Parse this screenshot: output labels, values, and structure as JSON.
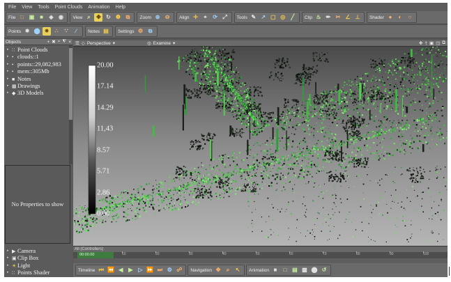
{
  "menu": [
    "File",
    "View",
    "Tools",
    "Point Clouds",
    "Animation",
    "Help"
  ],
  "toolbar1": [
    {
      "label": "File",
      "icons": [
        {
          "name": "new-icon",
          "glyph": "□"
        },
        {
          "name": "open-icon",
          "glyph": "▣"
        },
        {
          "name": "save-icon",
          "glyph": "■"
        },
        {
          "name": "import-icon",
          "glyph": "◈"
        },
        {
          "name": "export-icon",
          "glyph": "◉"
        }
      ]
    },
    {
      "label": "View",
      "icons": [
        {
          "name": "zoom-view-icon",
          "glyph": "⌕"
        },
        {
          "name": "pan-icon",
          "glyph": "✥",
          "active": true
        },
        {
          "name": "rotate-icon",
          "glyph": "↻"
        },
        {
          "name": "orbit-icon",
          "glyph": "❁"
        },
        {
          "name": "fit-icon",
          "glyph": "⧉"
        }
      ]
    },
    {
      "label": "Zoom",
      "icons": [
        {
          "name": "zoom-in-icon",
          "glyph": "⊕"
        },
        {
          "name": "zoom-out-icon",
          "glyph": "⊖"
        }
      ]
    },
    {
      "label": "Align",
      "icons": [
        {
          "name": "align-move-icon",
          "glyph": "✛"
        },
        {
          "name": "align-point-icon",
          "glyph": "⌖"
        },
        {
          "name": "align-rotate-icon",
          "glyph": "⟳"
        },
        {
          "name": "align-scale-icon",
          "glyph": "⤢"
        }
      ]
    },
    {
      "label": "Tools",
      "icons": [
        {
          "name": "pencil-icon",
          "glyph": "✎"
        },
        {
          "name": "measure-icon",
          "glyph": "↗"
        },
        {
          "name": "select-box-icon",
          "glyph": "▢"
        },
        {
          "name": "lasso-icon",
          "glyph": "◎"
        },
        {
          "name": "line-tool-icon",
          "glyph": "╱"
        }
      ]
    },
    {
      "label": "Clip",
      "icons": [
        {
          "name": "clip-fire-icon",
          "glyph": "♨"
        },
        {
          "name": "clip-pencil-icon",
          "glyph": "✏"
        },
        {
          "name": "clip-cut-icon",
          "glyph": "✂"
        },
        {
          "name": "clip-angle-icon",
          "glyph": "∠"
        },
        {
          "name": "clip-plane-icon",
          "glyph": "⊥"
        }
      ]
    },
    {
      "label": "Shader",
      "icons": [
        {
          "name": "shader-1-icon",
          "glyph": "●"
        },
        {
          "name": "shader-2-icon",
          "glyph": "◐"
        },
        {
          "name": "shader-3-icon",
          "glyph": "○"
        }
      ]
    }
  ],
  "toolbar2": [
    {
      "label": "Points",
      "icons": [
        {
          "name": "points-star-icon",
          "glyph": "✸"
        },
        {
          "name": "points-color-icon",
          "glyph": "⬤"
        },
        {
          "name": "points-active-icon",
          "glyph": "✷",
          "active": true
        },
        {
          "name": "points-spread-icon",
          "glyph": "∴"
        },
        {
          "name": "points-dots-icon",
          "glyph": "∵"
        },
        {
          "name": "points-slash-icon",
          "glyph": "∕"
        }
      ]
    },
    {
      "label": "Notes",
      "icons": [
        {
          "name": "notes-icon",
          "glyph": "▤"
        }
      ]
    },
    {
      "label": "Settings",
      "icons": [
        {
          "name": "settings-icon",
          "glyph": "⚙"
        },
        {
          "name": "windows-icon",
          "glyph": "⧉"
        }
      ]
    }
  ],
  "objects_panel": {
    "title": "Objects"
  },
  "tree": [
    {
      "label": "Point Clouds",
      "icon": "∷",
      "icon_name": "point-clouds-icon"
    },
    {
      "label": "clouds::1",
      "icon": "•",
      "icon_name": "bullet-icon"
    },
    {
      "label": "points::29,082,983",
      "icon": "•",
      "icon_name": "bullet-icon"
    },
    {
      "label": "mem::305Mb",
      "icon": "•",
      "icon_name": "bullet-icon"
    },
    {
      "label": "Notes",
      "icon": "■",
      "icon_name": "notes-tree-icon"
    },
    {
      "label": "Drawings",
      "icon": "▦",
      "icon_name": "drawings-icon"
    },
    {
      "label": "3D Models",
      "icon": "◆",
      "icon_name": "models-icon"
    }
  ],
  "properties": {
    "empty_text": "No Properties to show"
  },
  "viewport": {
    "view_mode": "Perspective",
    "navigation_mode": "Examine"
  },
  "legend": {
    "labels": [
      "20.00",
      "17.14",
      "14.29",
      "11,43",
      "8.57",
      "5.71",
      "2.86",
      "0.00"
    ]
  },
  "bottom_tree": [
    {
      "label": "Camera",
      "icon": "▶",
      "icon_name": "camera-icon"
    },
    {
      "label": "Clip Box",
      "icon": "▣",
      "icon_name": "clip-box-icon"
    },
    {
      "label": "Light",
      "icon": "☀",
      "icon_name": "light-icon"
    },
    {
      "label": "Points Shader",
      "icon": "∷",
      "icon_name": "points-shader-icon"
    }
  ],
  "timeline": {
    "header": "All (Controllers)",
    "position": "00:00.00",
    "ticks": [
      "10",
      "20",
      "30",
      "40",
      "50",
      "60",
      "70",
      "80",
      "90",
      "100"
    ]
  },
  "bottom_toolbar": [
    {
      "label": "Timeline",
      "icons": [
        {
          "name": "goto-start-icon",
          "glyph": "⏮"
        },
        {
          "name": "prev-key-icon",
          "glyph": "⏪"
        },
        {
          "name": "step-back-icon",
          "glyph": "◀"
        },
        {
          "name": "play-icon",
          "glyph": "▶"
        },
        {
          "name": "step-forward-icon",
          "glyph": "▷"
        },
        {
          "name": "next-key-icon",
          "glyph": "⏩"
        },
        {
          "name": "goto-end-icon",
          "glyph": "⏭"
        },
        {
          "name": "key-settings-icon",
          "glyph": "⚙"
        },
        {
          "name": "key-link-icon",
          "glyph": "☍"
        }
      ]
    },
    {
      "label": "Navigation",
      "icons": [
        {
          "name": "nav-move-icon",
          "glyph": "✥"
        },
        {
          "name": "nav-zoom-icon",
          "glyph": "⌕"
        },
        {
          "name": "nav-cursor-icon",
          "glyph": "↖"
        }
      ]
    },
    {
      "label": "Animation",
      "icons": [
        {
          "name": "anim-record-icon",
          "glyph": "■"
        },
        {
          "name": "anim-stop-icon",
          "glyph": "□"
        },
        {
          "name": "anim-film-icon",
          "glyph": "▤"
        },
        {
          "name": "anim-export-icon",
          "glyph": "▩"
        },
        {
          "name": "anim-render-icon",
          "glyph": "⬤"
        },
        {
          "name": "anim-loop-icon",
          "glyph": "↺"
        }
      ]
    }
  ],
  "colors": {
    "point_green": "#3fbf3f",
    "dark_cloud": "#1a1f1a",
    "bg_sky": "#9a9a9a"
  }
}
